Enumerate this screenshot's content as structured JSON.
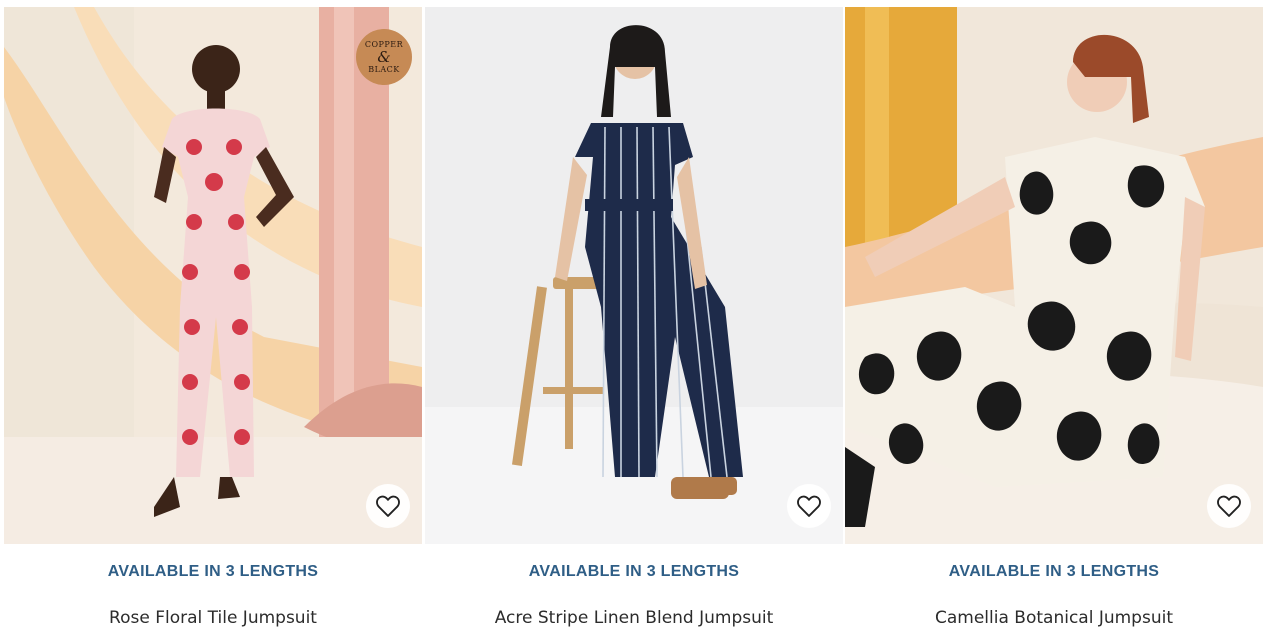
{
  "colors": {
    "availability_text": "#2f5e86",
    "badge_bg": "#c68a55",
    "name_text": "#2c2c2c"
  },
  "products": [
    {
      "availability": "AVAILABLE IN 3 LENGTHS",
      "name": "Rose Floral Tile Jumpsuit",
      "badge": {
        "line1": "COPPER",
        "line2": "&",
        "line3": "BLACK"
      },
      "wishlist_icon": "heart-outline-icon"
    },
    {
      "availability": "AVAILABLE IN 3 LENGTHS",
      "name": "Acre Stripe Linen Blend Jumpsuit",
      "wishlist_icon": "heart-outline-icon"
    },
    {
      "availability": "AVAILABLE IN 3 LENGTHS",
      "name": "Camellia Botanical Jumpsuit",
      "wishlist_icon": "heart-outline-icon"
    }
  ]
}
